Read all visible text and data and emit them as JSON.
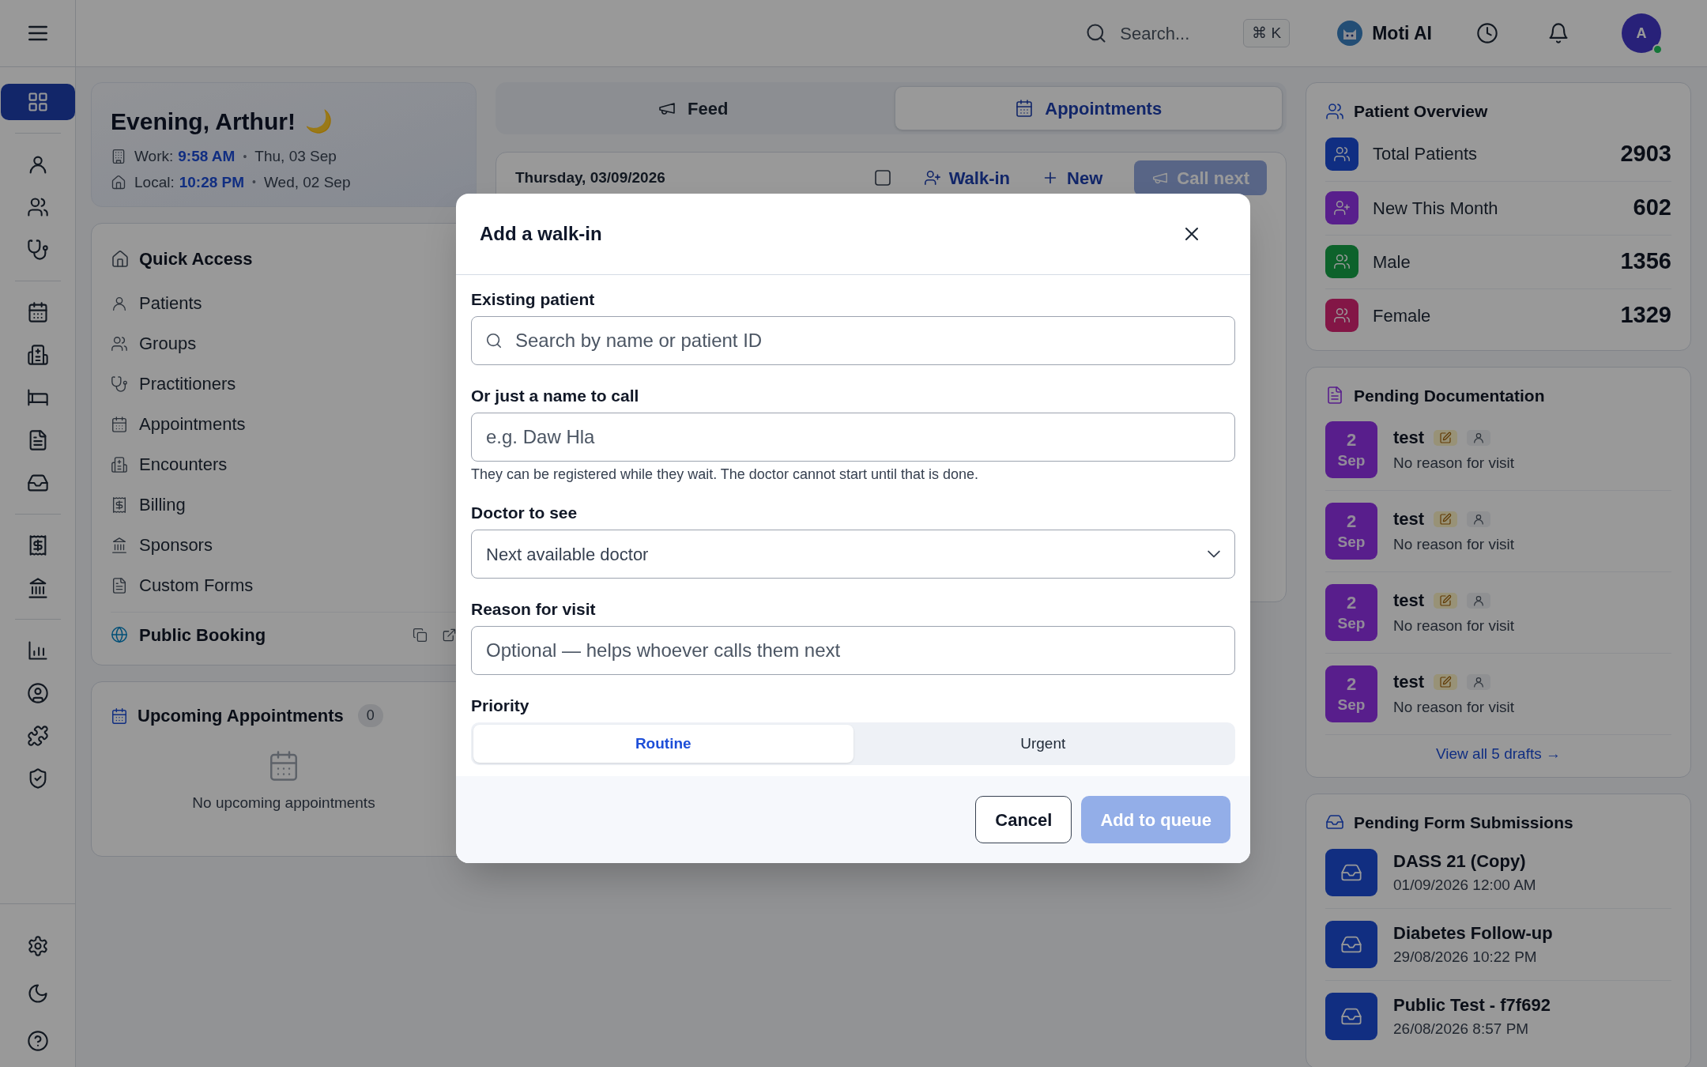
{
  "topbar": {
    "search_placeholder": "Search...",
    "shortcut": "⌘ K",
    "assistant": "Moti AI",
    "avatar": "A",
    "online": true
  },
  "sidebar": {
    "items": [
      {
        "selected": true
      },
      {
        "selected": false
      },
      {
        "selected": false
      },
      {
        "selected": false
      },
      {
        "selected": false
      },
      {
        "selected": false
      },
      {
        "selected": false
      },
      {
        "selected": false
      },
      {
        "selected": false
      },
      {
        "selected": false
      },
      {
        "selected": false
      },
      {
        "selected": false
      },
      {
        "selected": false
      },
      {
        "selected": false
      },
      {
        "selected": false
      },
      {
        "selected": false
      },
      {
        "selected": false
      },
      {
        "selected": false
      }
    ]
  },
  "greeting": {
    "title": "Evening, Arthur!",
    "emoji": "🌙",
    "separator": "•",
    "work_label": "Work:",
    "work_time": "9:58 AM",
    "work_date": "Thu, 03 Sep",
    "local_label": "Local:",
    "local_time": "10:28 PM",
    "local_date": "Wed, 02 Sep"
  },
  "quick_access": {
    "title": "Quick Access",
    "items": [
      {
        "label": "Patients",
        "kind": "item"
      },
      {
        "label": "Groups",
        "kind": "item"
      },
      {
        "label": "Practitioners",
        "kind": "item"
      },
      {
        "label": "Appointments",
        "kind": "item"
      },
      {
        "label": "Encounters",
        "kind": "item"
      },
      {
        "label": "Billing",
        "kind": "item"
      },
      {
        "label": "Sponsors",
        "kind": "item"
      },
      {
        "label": "Custom Forms",
        "kind": "item"
      },
      {
        "label": "Public Booking",
        "kind": "link"
      }
    ]
  },
  "upcoming": {
    "title": "Upcoming Appointments",
    "count": "0",
    "empty": "No upcoming appointments"
  },
  "tabs": [
    {
      "label": "Feed",
      "selected": false
    },
    {
      "label": "Appointments",
      "selected": true
    }
  ],
  "schedule": {
    "date": "Thursday, 03/09/2026",
    "buttons": [
      {
        "label": "Walk-in",
        "kind": "link"
      },
      {
        "label": "New",
        "kind": "link"
      },
      {
        "label": "Call next",
        "kind": "primary"
      }
    ]
  },
  "patient_overview": {
    "title": "Patient Overview",
    "stats": [
      {
        "label": "Total Patients",
        "value": "2903",
        "color": "#112f82"
      },
      {
        "label": "New This Month",
        "value": "602",
        "color": "#581f8c"
      },
      {
        "label": "Male",
        "value": "1356",
        "color": "#0d622c"
      },
      {
        "label": "Female",
        "value": "1329",
        "color": "#831747"
      }
    ]
  },
  "pending_documentation": {
    "title": "Pending Documentation",
    "items": [
      {
        "day": "2",
        "month": "Sep",
        "title": "test",
        "reason": "No reason for visit"
      },
      {
        "day": "2",
        "month": "Sep",
        "title": "test",
        "reason": "No reason for visit"
      },
      {
        "day": "2",
        "month": "Sep",
        "title": "test",
        "reason": "No reason for visit"
      },
      {
        "day": "2",
        "month": "Sep",
        "title": "test",
        "reason": "No reason for visit"
      }
    ],
    "link": "View all 5 drafts →"
  },
  "pending_forms": {
    "title": "Pending Form Submissions",
    "items": [
      {
        "title": "DASS 21 (Copy)",
        "date": "01/09/2026 12:00 AM"
      },
      {
        "title": "Diabetes Follow-up",
        "date": "29/08/2026 10:22 PM"
      },
      {
        "title": "Public Test - f7f692",
        "date": "26/08/2026 8:57 PM"
      }
    ]
  },
  "dialog": {
    "title": "Add a walk-in",
    "existing_label": "Existing patient",
    "existing_placeholder": "Search by name or patient ID",
    "name_label": "Or just a name to call",
    "name_placeholder": "e.g. Daw Hla",
    "name_hint": "They can be registered while they wait. The doctor cannot start until that is done.",
    "doctor_label": "Doctor to see",
    "doctor_value": "Next available doctor",
    "reason_label": "Reason for visit",
    "reason_placeholder": "Optional — helps whoever calls them next",
    "priority_label": "Priority",
    "priority_options": [
      {
        "label": "Routine",
        "selected": true
      },
      {
        "label": "Urgent",
        "selected": false
      }
    ],
    "cancel": "Cancel",
    "submit": "Add to queue",
    "submit_disabled": true
  }
}
